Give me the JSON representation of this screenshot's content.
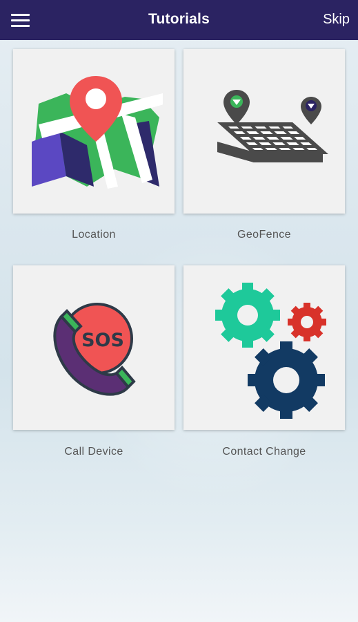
{
  "header": {
    "menu_icon": "hamburger-menu-icon",
    "title": "Tutorials",
    "skip_label": "Skip"
  },
  "tiles": [
    {
      "label": "Location",
      "icon": "map-pin-icon"
    },
    {
      "label": "GeoFence",
      "icon": "geofence-grid-icon"
    },
    {
      "label": "Call Device",
      "icon": "sos-phone-icon",
      "icon_text": "SOS"
    },
    {
      "label": "Contact Change",
      "icon": "gears-icon"
    }
  ],
  "colors": {
    "header_bg": "#2b2362",
    "tile_bg": "#f1f1f1",
    "pin_red": "#f05454",
    "map_green": "#3bb55a",
    "map_purple": "#5b48c2",
    "gear_teal": "#1ec99a",
    "gear_red": "#d8322a",
    "gear_navy": "#123a63"
  }
}
